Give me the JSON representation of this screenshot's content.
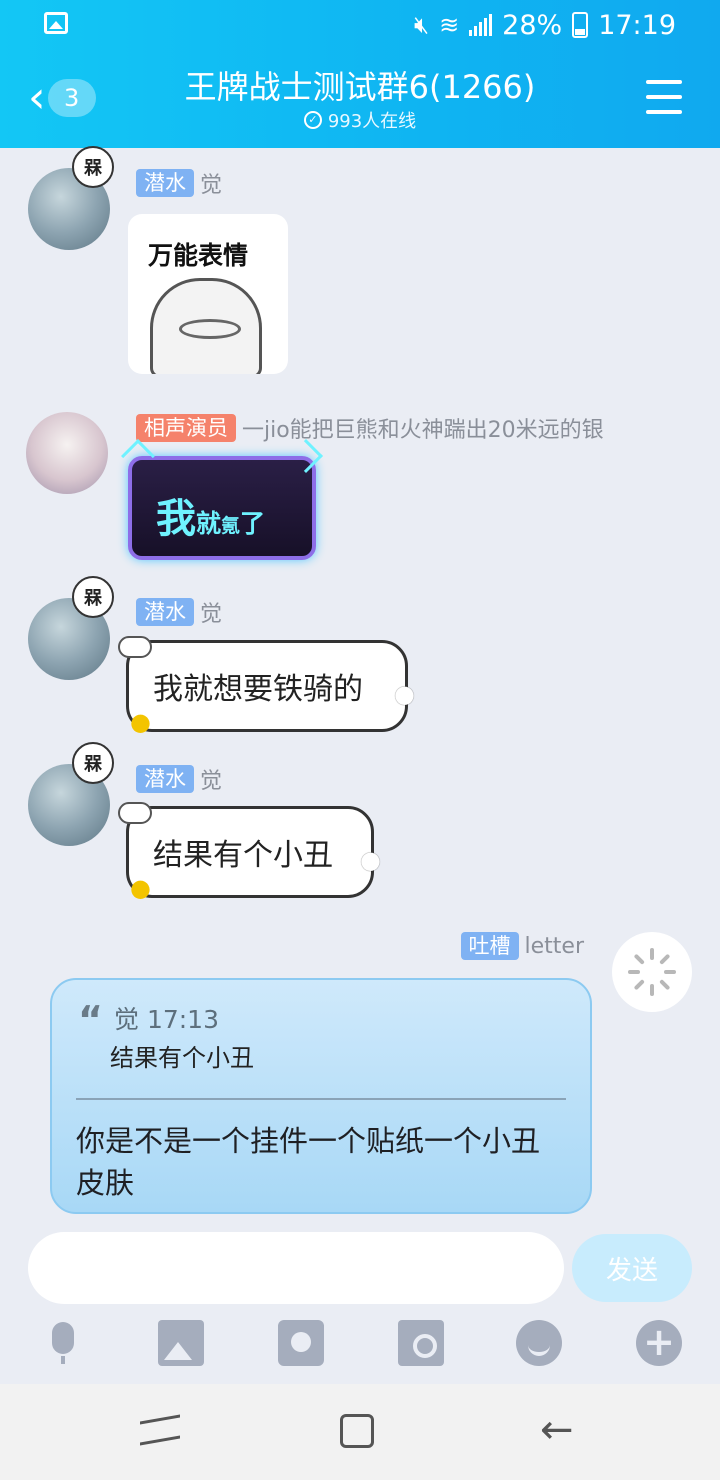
{
  "status": {
    "battery": "28%",
    "time": "17:19"
  },
  "header": {
    "back_count": "3",
    "title": "王牌战士测试群6(1266)",
    "online": "993人在线"
  },
  "messages": [
    {
      "sender_tag": "潜水",
      "sender_name": "觉",
      "badge": "槑",
      "type": "sticker",
      "sticker_caption": "万能表情"
    },
    {
      "sender_tag": "相声演员",
      "sender_name": "一jio能把巨熊和火神踹出20米远的银",
      "type": "sticker",
      "sticker_text": [
        "我",
        "就",
        "氪",
        "了"
      ]
    },
    {
      "sender_tag": "潜水",
      "sender_name": "觉",
      "badge": "槑",
      "type": "text",
      "text": "我就想要铁骑的"
    },
    {
      "sender_tag": "潜水",
      "sender_name": "觉",
      "badge": "槑",
      "type": "text",
      "text": "结果有个小丑"
    }
  ],
  "my_message": {
    "sender_tag": "吐槽",
    "sender_name": "letter",
    "quote_header": "觉 17:13",
    "quote_text": "结果有个小丑",
    "text": "你是不是一个挂件一个贴纸一个小丑皮肤"
  },
  "input": {
    "placeholder": "",
    "send_label": "发送"
  },
  "colors": {
    "header": "#13c7f5",
    "tag_blue": "#7fb2f3",
    "tag_red": "#f5826b",
    "my_bubble": "#a8d8f6"
  }
}
